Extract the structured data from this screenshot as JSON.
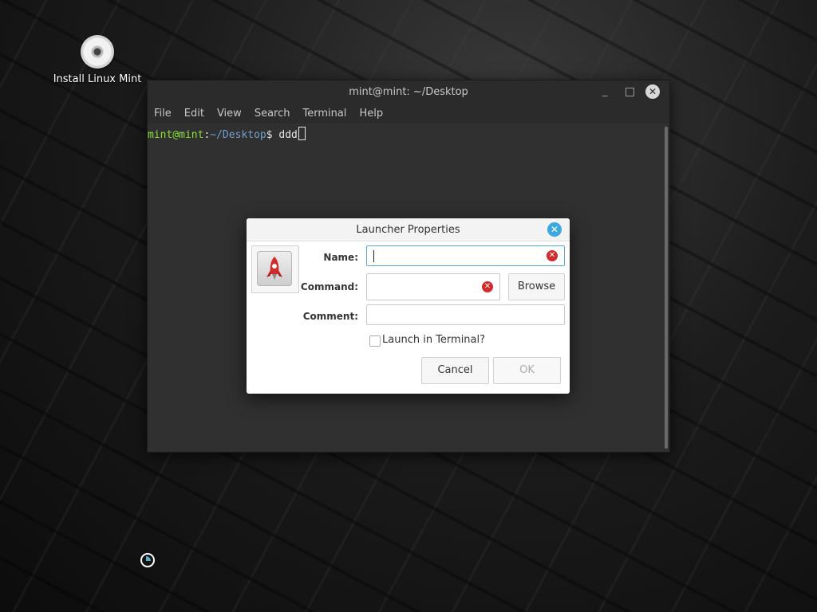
{
  "desktop": {
    "icons": [
      {
        "label": "Install Linux Mint",
        "icon": "disc-icon"
      }
    ]
  },
  "terminal": {
    "title": "mint@mint: ~/Desktop",
    "menu": [
      "File",
      "Edit",
      "View",
      "Search",
      "Terminal",
      "Help"
    ],
    "prompt_user": "mint@mint",
    "prompt_sep": ":",
    "prompt_path": "~/Desktop",
    "prompt_symbol": "$ ",
    "command": "ddd"
  },
  "dialog": {
    "title": "Launcher Properties",
    "icon": "rocket-icon",
    "name_label": "Name:",
    "name_value": "",
    "command_label": "Command:",
    "command_value": "",
    "comment_label": "Comment:",
    "comment_value": "",
    "browse_label": "Browse",
    "terminal_checkbox_label": "Launch in Terminal?",
    "terminal_checked": false,
    "cancel_label": "Cancel",
    "ok_label": "OK"
  },
  "colors": {
    "prompt_user": "#8ae234",
    "prompt_path": "#729fcf",
    "dialog_close": "#3ca7e0",
    "clear_icon": "#d32b2b"
  }
}
